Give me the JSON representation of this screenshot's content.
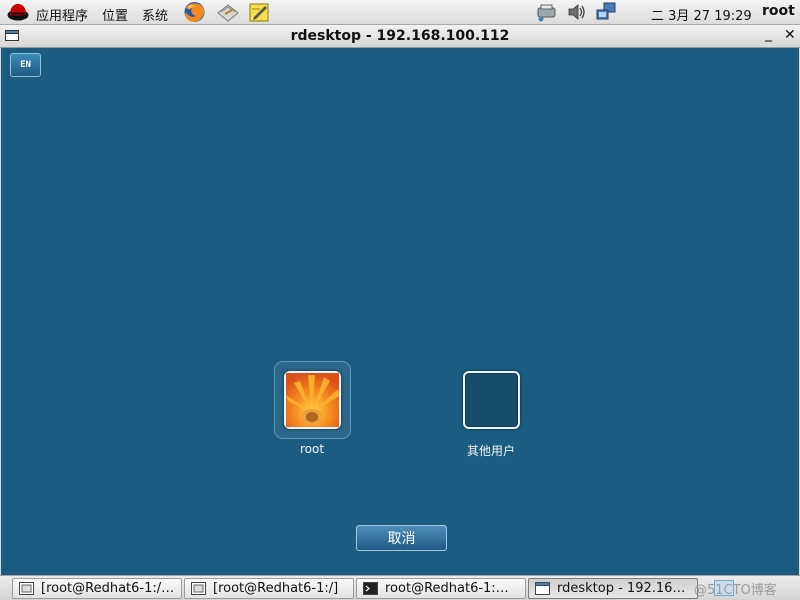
{
  "top_panel": {
    "menus": [
      "应用程序",
      "位置",
      "系统"
    ],
    "launchers": [
      "firefox-icon",
      "mail-icon",
      "note-editor-icon"
    ],
    "tray": [
      "network-printer-icon",
      "volume-icon",
      "network-icon"
    ],
    "clock": "二 3月 27 19:29",
    "user": "root"
  },
  "window": {
    "title": "rdesktop - 192.168.100.112",
    "minimize": "_",
    "close": "✕"
  },
  "login": {
    "lang_button": "EN",
    "users": [
      {
        "name": "root",
        "selected": true
      },
      {
        "name": "其他用户",
        "selected": false
      }
    ],
    "cancel": "取消",
    "bg_color": "#1a5d80"
  },
  "taskbar": {
    "items": [
      {
        "label": "[root@Redhat6-1:/…",
        "active": false
      },
      {
        "label": "[root@Redhat6-1:/]",
        "active": false
      },
      {
        "label": "root@Redhat6-1:…",
        "active": false
      },
      {
        "label": "rdesktop - 192.16…",
        "active": true
      }
    ],
    "watermark": "@51CTO博客"
  }
}
